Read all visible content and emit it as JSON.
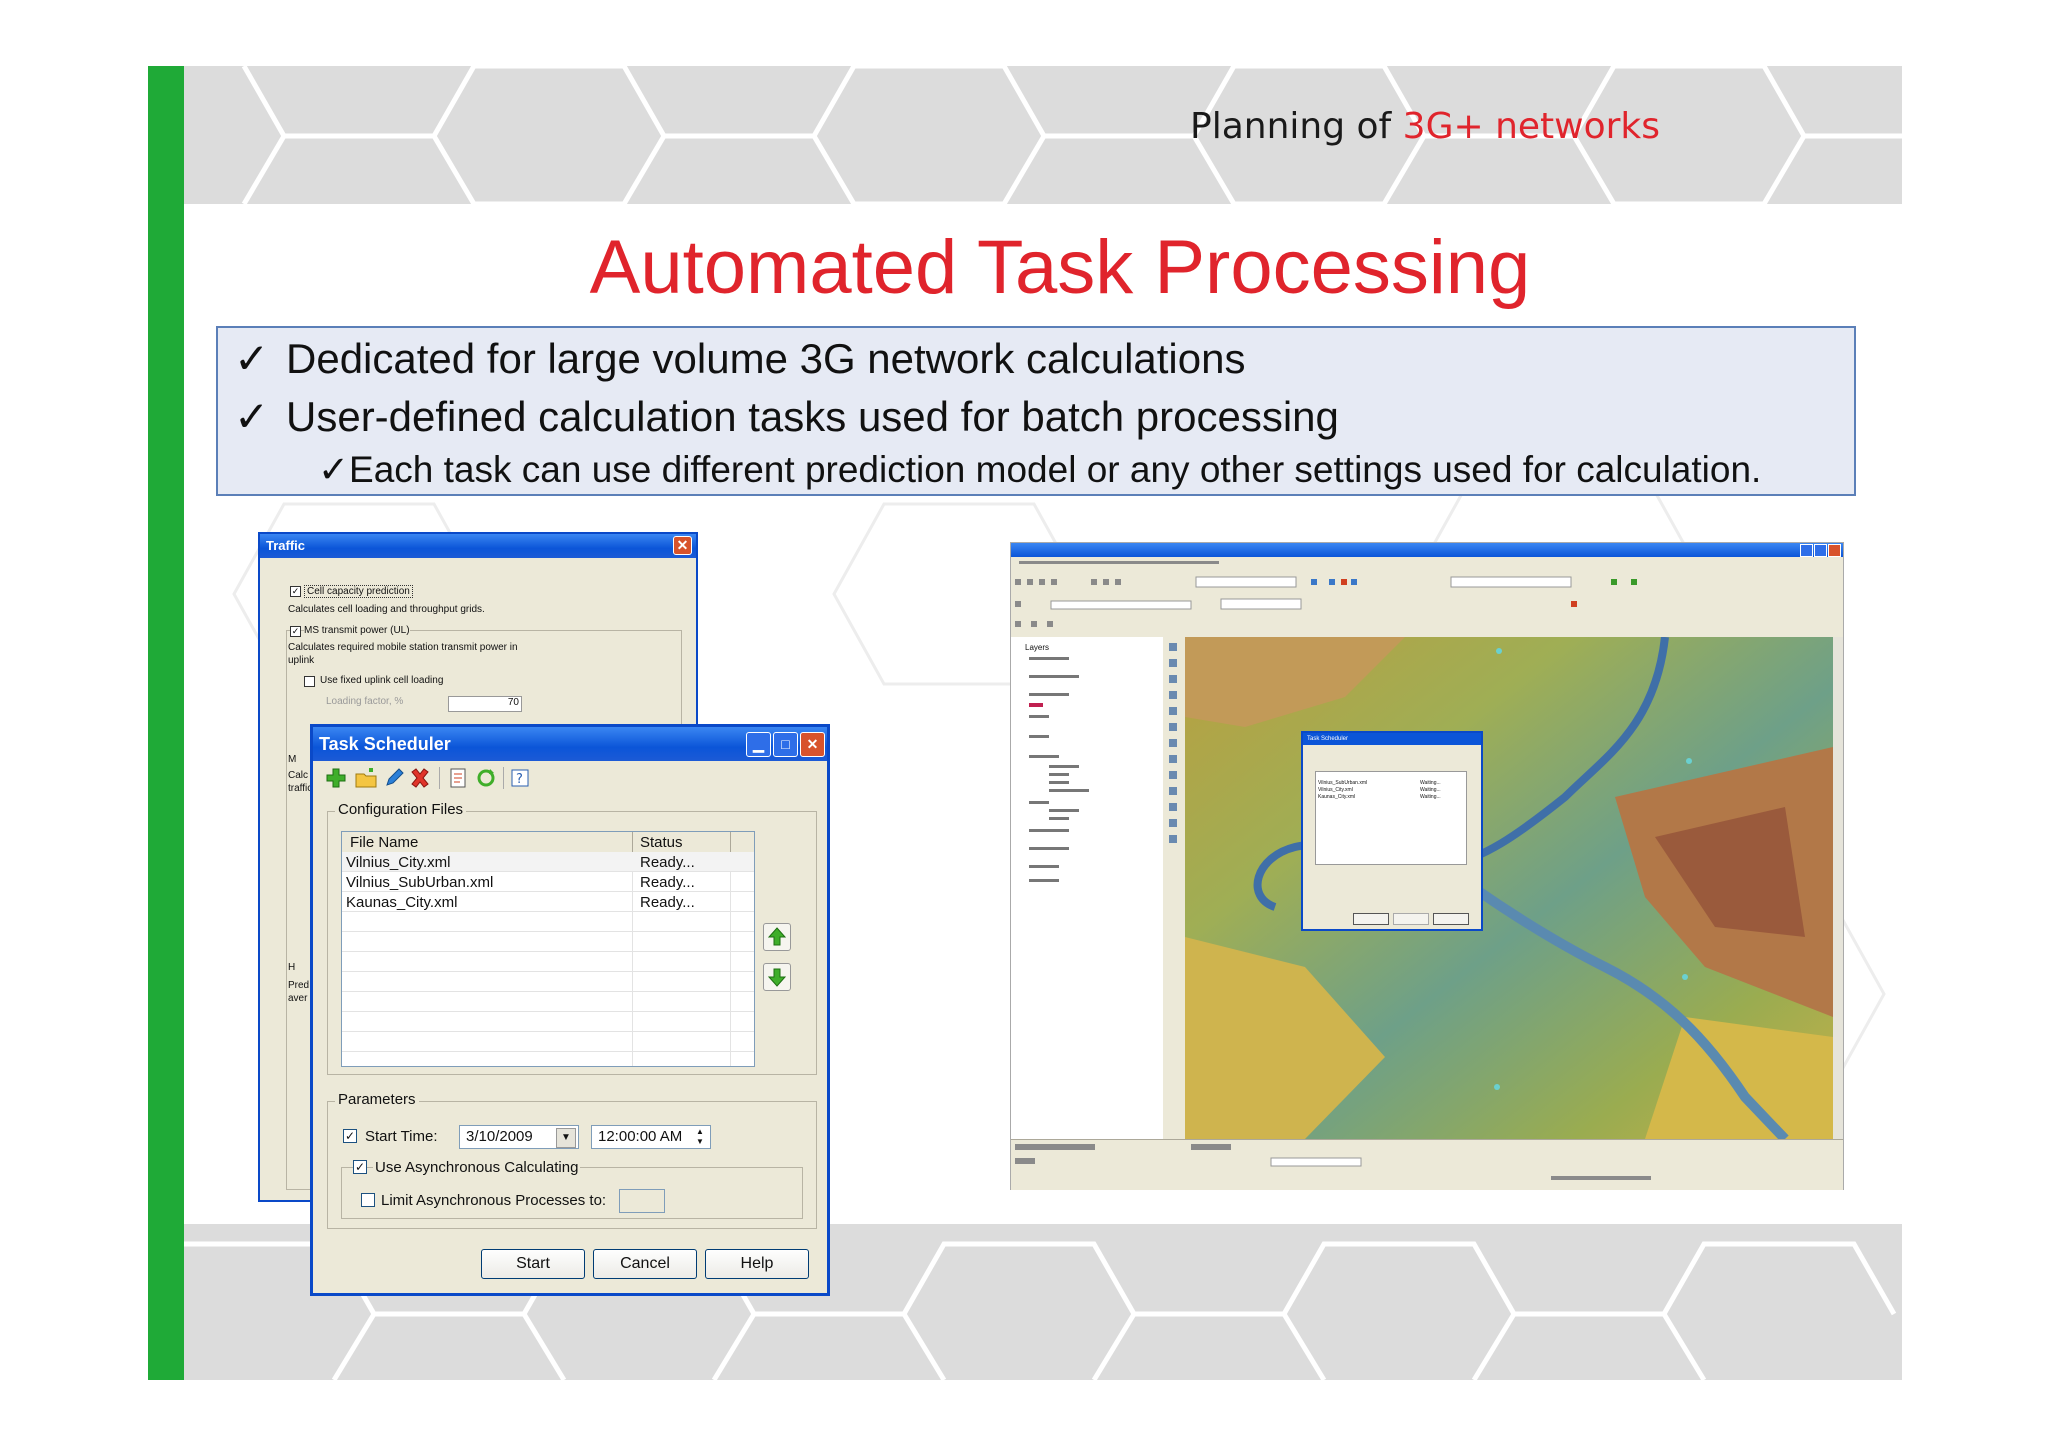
{
  "header": {
    "prefix": "Planning of ",
    "accent": "3G+ networks"
  },
  "title": "Automated Task Processing",
  "bullets": [
    {
      "mark": "✓",
      "text": "Dedicated for large volume 3G network calculations"
    },
    {
      "mark": "✓",
      "text": "User-defined calculation tasks used for batch processing"
    },
    {
      "mark": "✓",
      "text": "Each task can use different prediction model or any other settings used for calculation."
    }
  ],
  "traffic_dialog": {
    "title": "Traffic",
    "cell_capacity_label": "Cell capacity prediction",
    "cell_capacity_desc": "Calculates cell loading and throughput grids.",
    "ms_power_label": "MS transmit power (UL)",
    "ms_power_desc_1": "Calculates required mobile station transmit power in",
    "ms_power_desc_2": "uplink",
    "fixed_loading_label": "Use fixed uplink cell loading",
    "loading_factor_label": "Loading factor, %",
    "loading_factor_value": "70",
    "partial_labels": [
      "M",
      "Calc",
      "traffic",
      "H",
      "Pred",
      "aver"
    ]
  },
  "task_scheduler": {
    "title": "Task Scheduler",
    "config_group_label": "Configuration Files",
    "columns": [
      "File Name",
      "Status"
    ],
    "rows": [
      {
        "file": "Vilnius_City.xml",
        "status": "Ready..."
      },
      {
        "file": "Vilnius_SubUrban.xml",
        "status": "Ready..."
      },
      {
        "file": "Kaunas_City.xml",
        "status": "Ready..."
      }
    ],
    "params_group_label": "Parameters",
    "start_time_label": "Start Time:",
    "start_date": "3/10/2009",
    "start_time": "12:00:00 AM",
    "async_label": "Use Asynchronous Calculating",
    "limit_label": "Limit Asynchronous Processes to:",
    "buttons": {
      "start": "Start",
      "cancel": "Cancel",
      "help": "Help"
    }
  },
  "gis_window": {
    "layers_title": "Layers",
    "mini_dialog_title": "Task Scheduler",
    "mini_rows": [
      {
        "file": "Vilnius_SubUrban.xml",
        "status": "Waiting..."
      },
      {
        "file": "Vilnius_City.xml",
        "status": "Waiting..."
      },
      {
        "file": "Kaunas_City.xml",
        "status": "Waiting..."
      }
    ]
  },
  "colors": {
    "accent_red": "#e0242c",
    "green_bar": "#1faa37",
    "xp_blue": "#0a49c8",
    "panel_bg": "#e6eaf4"
  }
}
